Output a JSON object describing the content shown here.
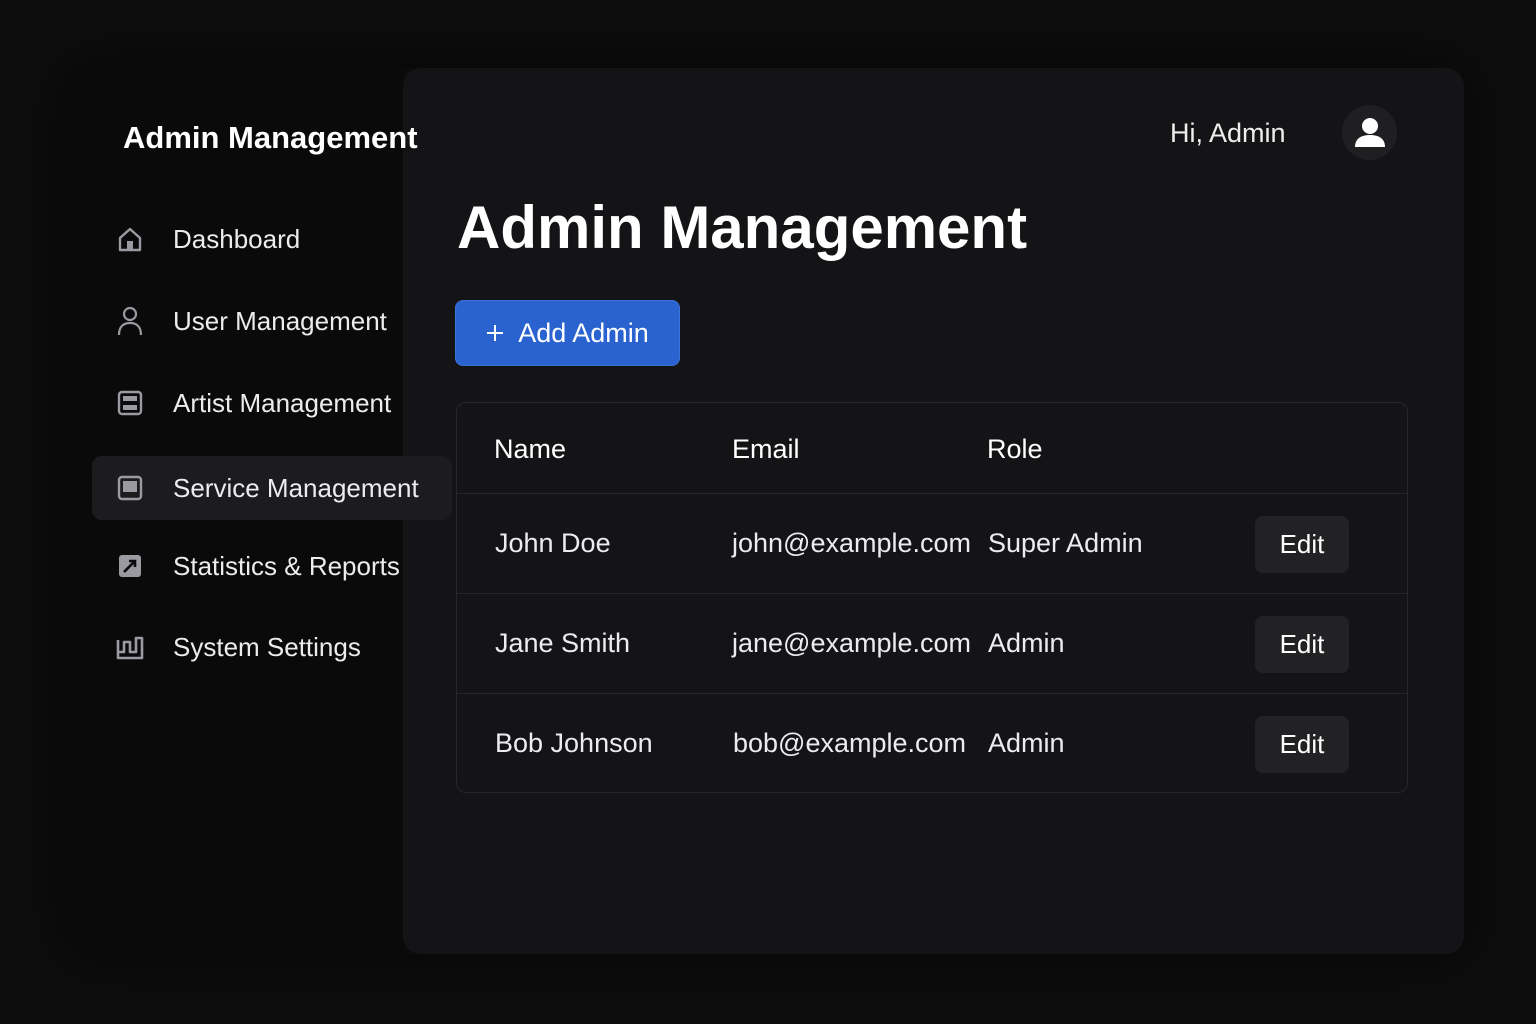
{
  "sidebar": {
    "brand": "Admin Management",
    "items": [
      {
        "label": "Dashboard",
        "icon": "home-icon"
      },
      {
        "label": "User Management",
        "icon": "user-icon"
      },
      {
        "label": "Artist Management",
        "icon": "artist-icon"
      },
      {
        "label": "Service Management",
        "icon": "service-icon",
        "active": true
      },
      {
        "label": "Statistics & Reports",
        "icon": "chart-icon"
      },
      {
        "label": "System Settings",
        "icon": "settings-icon"
      }
    ]
  },
  "header": {
    "greeting": "Hi, Admin",
    "avatar_icon": "user-avatar-icon"
  },
  "main": {
    "title": "Admin Management",
    "add_button": {
      "icon": "plus",
      "label": "Add Admin"
    },
    "table": {
      "columns": [
        "Name",
        "Email",
        "Role"
      ],
      "rows": [
        {
          "name": "John Doe",
          "email": "john@example.com",
          "role": "Super Admin",
          "action": "Edit"
        },
        {
          "name": "Jane Smith",
          "email": "jane@example.com",
          "role": "Admin",
          "action": "Edit"
        },
        {
          "name": "Bob Johnson",
          "email": "bob@example.com",
          "role": "Admin",
          "action": "Edit"
        }
      ]
    }
  },
  "colors": {
    "background": "#0d0d0e",
    "panel": "#141416",
    "accent": "#2a63cf",
    "active_nav": "#1c1c1f"
  }
}
